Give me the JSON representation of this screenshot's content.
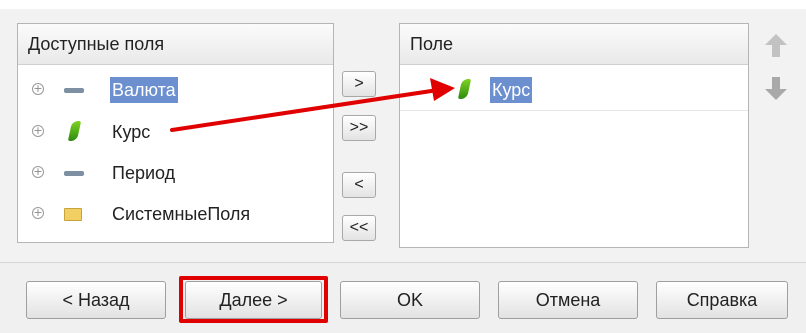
{
  "available_fields": {
    "header": "Доступные поля",
    "items": [
      {
        "label": "Валюта",
        "icon": "dash-icon",
        "selected": true
      },
      {
        "label": "Курс",
        "icon": "leaf-icon",
        "selected": false
      },
      {
        "label": "Период",
        "icon": "dash-icon",
        "selected": false
      },
      {
        "label": "СистемныеПоля",
        "icon": "folder-icon",
        "selected": false
      }
    ]
  },
  "transfer_buttons": {
    "add": ">",
    "add_all": ">>",
    "remove": "<",
    "remove_all": "<<"
  },
  "selected_fields": {
    "header": "Поле",
    "items": [
      {
        "label": "Курс",
        "icon": "leaf-icon",
        "selected": true
      }
    ]
  },
  "footer": {
    "back": "< Назад",
    "next": "Далее >",
    "ok": "OK",
    "cancel": "Отмена",
    "help": "Справка"
  },
  "colors": {
    "selection": "#6c8fd0",
    "annotation_red": "#e00000"
  }
}
